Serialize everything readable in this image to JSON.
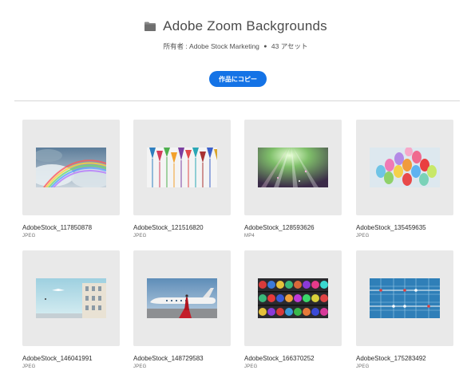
{
  "header": {
    "title": "Adobe Zoom Backgrounds",
    "owner": "所有者 : Adobe Stock Marketing",
    "asset_count": "43 アセット",
    "copy_button": "作品にコピー"
  },
  "assets": [
    {
      "name": "AdobeStock_117850878",
      "type": "JPEG",
      "thumb": "rainbow-clouds"
    },
    {
      "name": "AdobeStock_121516820",
      "type": "JPEG",
      "thumb": "wine-glasses"
    },
    {
      "name": "AdobeStock_128593626",
      "type": "MP4",
      "thumb": "light-rays"
    },
    {
      "name": "AdobeStock_135459635",
      "type": "JPEG",
      "thumb": "colored-eggs"
    },
    {
      "name": "AdobeStock_146041991",
      "type": "JPEG",
      "thumb": "sky-buildings"
    },
    {
      "name": "AdobeStock_148729583",
      "type": "JPEG",
      "thumb": "airplane-red-carpet"
    },
    {
      "name": "AdobeStock_166370252",
      "type": "JPEG",
      "thumb": "bowling-balls"
    },
    {
      "name": "AdobeStock_175283492",
      "type": "JPEG",
      "thumb": "foosball-table"
    }
  ]
}
